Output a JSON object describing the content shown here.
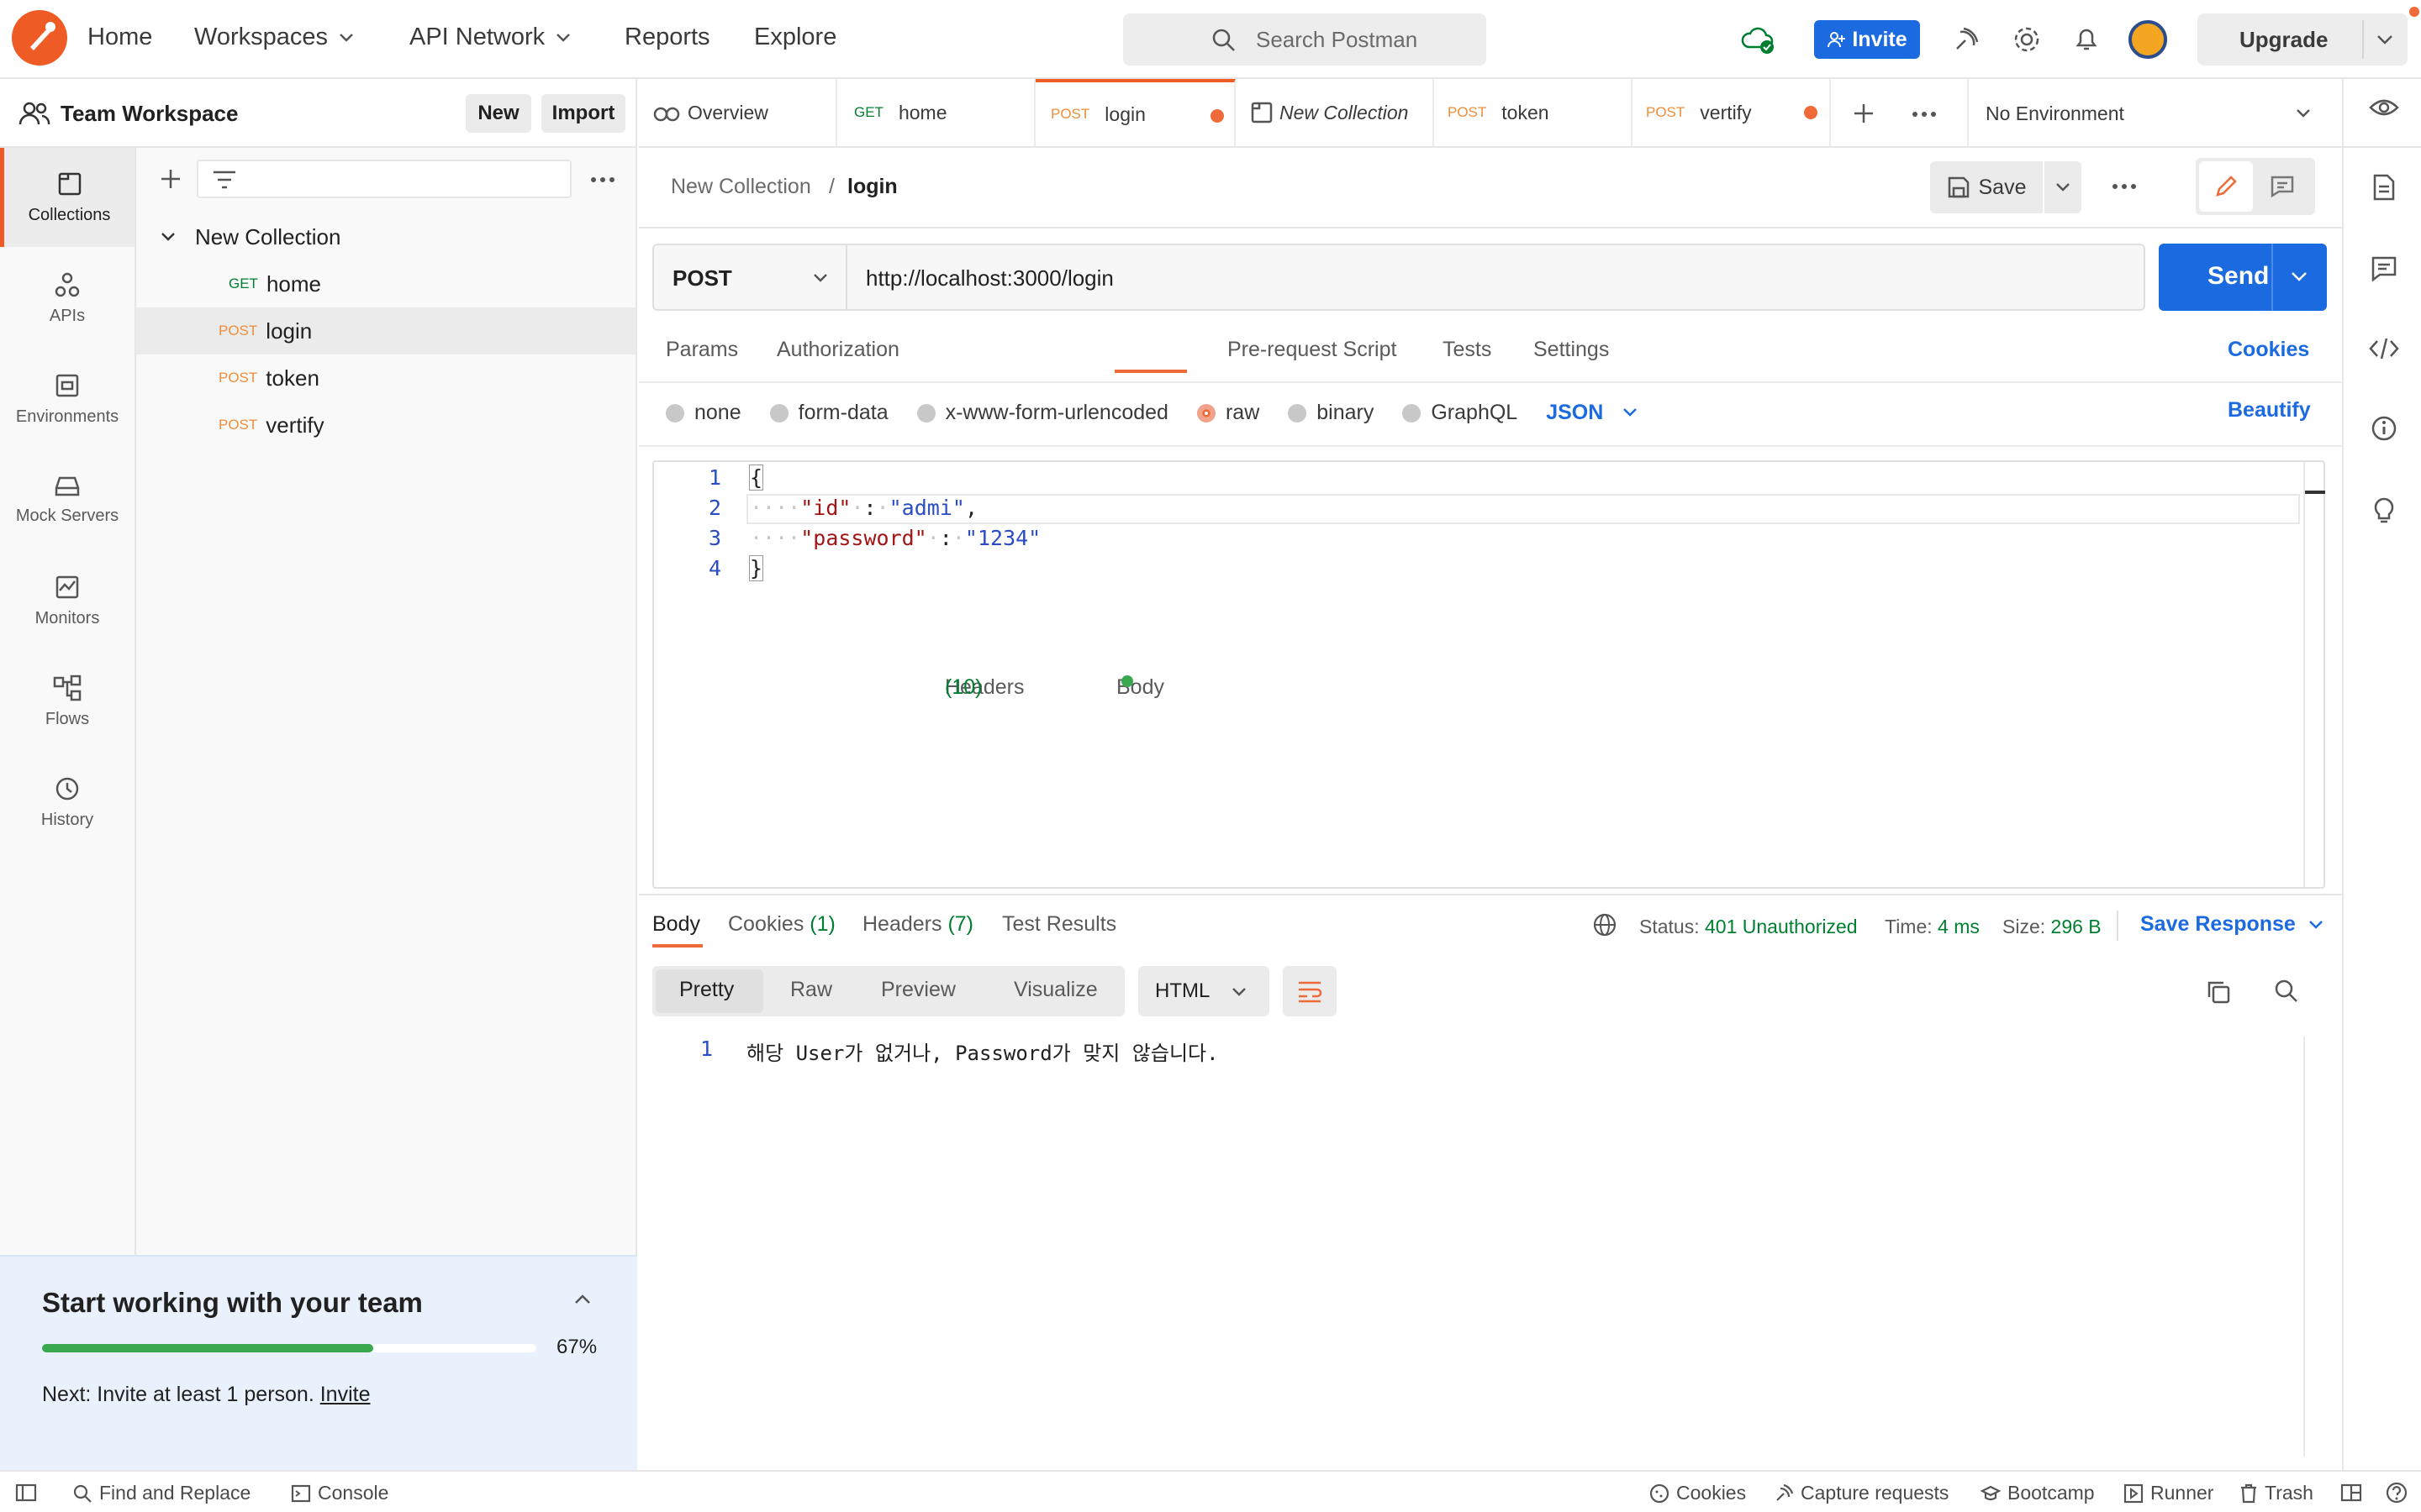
{
  "topbar": {
    "nav": [
      "Home",
      "Workspaces",
      "API Network",
      "Reports",
      "Explore"
    ],
    "search_placeholder": "Search Postman",
    "invite_label": "Invite",
    "upgrade_label": "Upgrade"
  },
  "workspace": {
    "name": "Team Workspace",
    "new_label": "New",
    "import_label": "Import"
  },
  "rail": [
    {
      "label": "Collections",
      "icon": "collections-icon"
    },
    {
      "label": "APIs",
      "icon": "apis-icon"
    },
    {
      "label": "Environments",
      "icon": "environments-icon"
    },
    {
      "label": "Mock Servers",
      "icon": "mock-servers-icon"
    },
    {
      "label": "Monitors",
      "icon": "monitors-icon"
    },
    {
      "label": "Flows",
      "icon": "flows-icon"
    },
    {
      "label": "History",
      "icon": "history-icon"
    }
  ],
  "collection": {
    "name": "New Collection",
    "requests": [
      {
        "method": "GET",
        "name": "home"
      },
      {
        "method": "POST",
        "name": "login"
      },
      {
        "method": "POST",
        "name": "token"
      },
      {
        "method": "POST",
        "name": "vertify"
      }
    ]
  },
  "team_card": {
    "title": "Start working with your team",
    "progress": 67,
    "progress_label": "67%",
    "next_text": "Next: Invite at least 1 person.",
    "next_link": "Invite"
  },
  "tabs": [
    {
      "method": "",
      "label": "Overview"
    },
    {
      "method": "GET",
      "label": "home"
    },
    {
      "method": "POST",
      "label": "login"
    },
    {
      "method": "",
      "label": "New Collection"
    },
    {
      "method": "POST",
      "label": "token"
    },
    {
      "method": "POST",
      "label": "vertify"
    }
  ],
  "environment": "No Environment",
  "request": {
    "breadcrumb_collection": "New Collection",
    "breadcrumb_sep": "/",
    "breadcrumb_request": "login",
    "save_label": "Save",
    "method": "POST",
    "url": "http://localhost:3000/login",
    "send_label": "Send",
    "tabs": {
      "params": "Params",
      "authorization": "Authorization",
      "headers": "Headers",
      "headers_count": "(10)",
      "body": "Body",
      "prerequest": "Pre-request Script",
      "tests": "Tests",
      "settings": "Settings"
    },
    "cookies_label": "Cookies",
    "body_types": [
      "none",
      "form-data",
      "x-www-form-urlencoded",
      "raw",
      "binary",
      "GraphQL"
    ],
    "body_format": "JSON",
    "beautify_label": "Beautify",
    "code": {
      "l1": "1",
      "l2": "2",
      "l3": "3",
      "l4": "4",
      "open": "{",
      "k1": "\"id\"",
      "v1": "\"admi\"",
      "k2": "\"password\"",
      "v2": "\"1234\"",
      "colon": ":",
      "comma": ",",
      "close": "}"
    }
  },
  "response": {
    "tabs": {
      "body": "Body",
      "cookies": "Cookies",
      "cookies_count": "(1)",
      "headers": "Headers",
      "headers_count": "(7)",
      "tests": "Test Results"
    },
    "status_label": "Status:",
    "status_value": "401 Unauthorized",
    "time_label": "Time:",
    "time_value": "4 ms",
    "size_label": "Size:",
    "size_value": "296 B",
    "save_response": "Save Response",
    "views": [
      "Pretty",
      "Raw",
      "Preview",
      "Visualize"
    ],
    "format": "HTML",
    "line1": "1",
    "body_text": "해당 User가 없거나, Password가 맞지 않습니다."
  },
  "footer": {
    "find_replace": "Find and Replace",
    "console": "Console",
    "cookies": "Cookies",
    "capture": "Capture requests",
    "bootcamp": "Bootcamp",
    "runner": "Runner",
    "trash": "Trash"
  }
}
